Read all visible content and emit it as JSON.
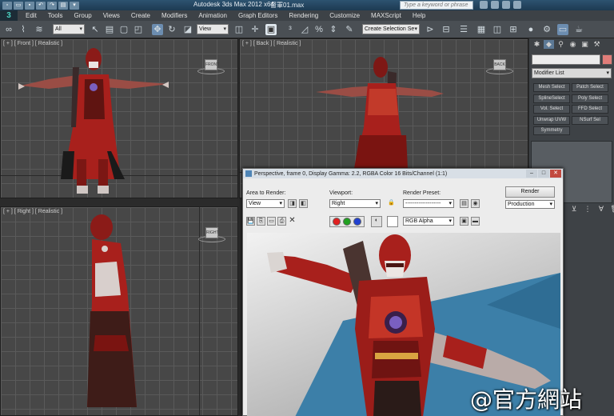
{
  "app": {
    "title": "Autodesk 3ds Max  2012 x64",
    "document": "督軍01.max",
    "search_placeholder": "Type a keyword or phrase",
    "logo_glyph": "3"
  },
  "menu": [
    "Edit",
    "Tools",
    "Group",
    "Views",
    "Create",
    "Modifiers",
    "Animation",
    "Graph Editors",
    "Rendering",
    "Customize",
    "MAXScript",
    "Help"
  ],
  "toolbar": {
    "selection_filter": "All",
    "reference_coord": "View",
    "named_selection_placeholder": "Create Selection Se"
  },
  "viewports": {
    "front": "[ + ] [ Front ] [ Realistic ]",
    "back": "[ + ] [ Back ] [ Realistic ]",
    "right": "[ + ] [ Right ] [ Realistic ]",
    "front_cube": "FRONT",
    "back_cube": "BACK",
    "right_cube": "RIGHT"
  },
  "command_panel": {
    "modifier_list": "Modifier List",
    "buttons": [
      "Mesh Select",
      "Patch Select",
      "SplineSelect",
      "Poly Select",
      "Vol. Select",
      "FFD Select",
      "Unwrap UVW",
      "NSurf Sel",
      "Symmetry"
    ]
  },
  "render_window": {
    "title": "Perspective, frame 0, Display Gamma: 2.2, RGBA Color 16 Bits/Channel (1:1)",
    "area_label": "Area to Render:",
    "area_value": "View",
    "viewport_label": "Viewport:",
    "viewport_value": "Right",
    "preset_label": "Render Preset:",
    "preset_value": "-------------------",
    "render_button": "Render",
    "mode_value": "Production",
    "channel_value": "RGB Alpha"
  },
  "watermark": "@官方網站",
  "colors": {
    "titlebar": "#1d3a52",
    "viewport_bg": "#474747",
    "costume_red": "#a8201c",
    "floor_blue": "#3c7fa8"
  }
}
